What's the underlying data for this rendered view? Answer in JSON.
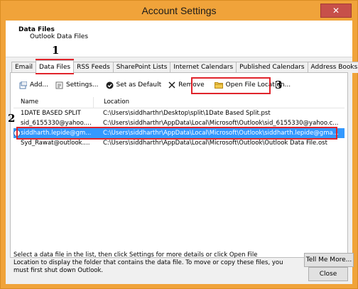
{
  "window": {
    "title": "Account Settings",
    "close_glyph": "✕"
  },
  "header": {
    "title": "Data Files",
    "subtitle": "Outlook Data Files"
  },
  "tabs": [
    {
      "label": "Email"
    },
    {
      "label": "Data Files",
      "active": true
    },
    {
      "label": "RSS Feeds"
    },
    {
      "label": "SharePoint Lists"
    },
    {
      "label": "Internet Calendars"
    },
    {
      "label": "Published Calendars"
    },
    {
      "label": "Address Books"
    }
  ],
  "toolbar": {
    "add": "Add...",
    "settings": "Settings...",
    "set_default": "Set as Default",
    "remove": "Remove",
    "open_location": "Open File Location..."
  },
  "grid": {
    "columns": {
      "name": "Name",
      "location": "Location"
    },
    "rows": [
      {
        "name": "1DATE BASED SPLIT",
        "location": "C:\\Users\\siddharthr\\Desktop\\split\\1Date Based Split.pst",
        "selected": false
      },
      {
        "name": "sid_6155330@yahoo.c...",
        "location": "C:\\Users\\siddharthr\\AppData\\Local\\Microsoft\\Outlook\\sid_6155330@yahoo.c...",
        "selected": false
      },
      {
        "name": "siddharth.lepide@gm...",
        "location": "C:\\Users\\siddharthr\\AppData\\Local\\Microsoft\\Outlook\\siddharth.lepide@gma...",
        "selected": true
      },
      {
        "name": "Syd_Rawat@outlook....",
        "location": "C:\\Users\\siddharthr\\AppData\\Local\\Microsoft\\Outlook\\Outlook Data File.ost",
        "selected": false
      }
    ]
  },
  "hint_text": "Select a data file in the list, then click Settings for more details or click Open File Location to display the folder that contains the data file. To move or copy these files, you must first shut down Outlook.",
  "buttons": {
    "tell_me_more": "Tell Me More...",
    "close": "Close"
  },
  "annotations": {
    "step1": "1",
    "step2": "2",
    "step3": "3"
  },
  "colors": {
    "annotation_red": "#e0242b",
    "selection_blue": "#3399ff",
    "title_bar": "#f0a33a"
  },
  "icons": {
    "add": "add-icon",
    "settings": "settings-icon",
    "set_default": "checkmark-circle-icon",
    "remove": "remove-x-icon",
    "open_location": "folder-icon",
    "default_marker": "default-check-icon"
  }
}
